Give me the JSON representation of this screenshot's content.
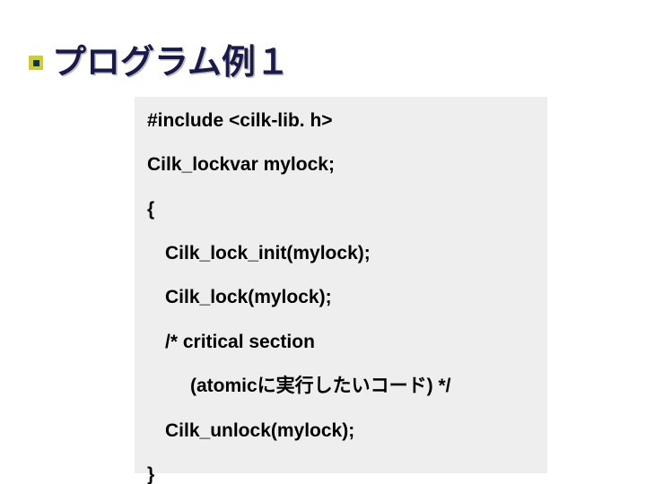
{
  "title": "プログラム例１",
  "code": {
    "l1": "#include <cilk-lib. h>",
    "l2": "Cilk_lockvar mylock;",
    "l3": "{",
    "l4": "Cilk_lock_init(mylock);",
    "l5": "Cilk_lock(mylock);",
    "l6": "/* critical section",
    "l7": "(atomicに実行したいコード) */",
    "l8": "Cilk_unlock(mylock);",
    "l9": "}"
  }
}
